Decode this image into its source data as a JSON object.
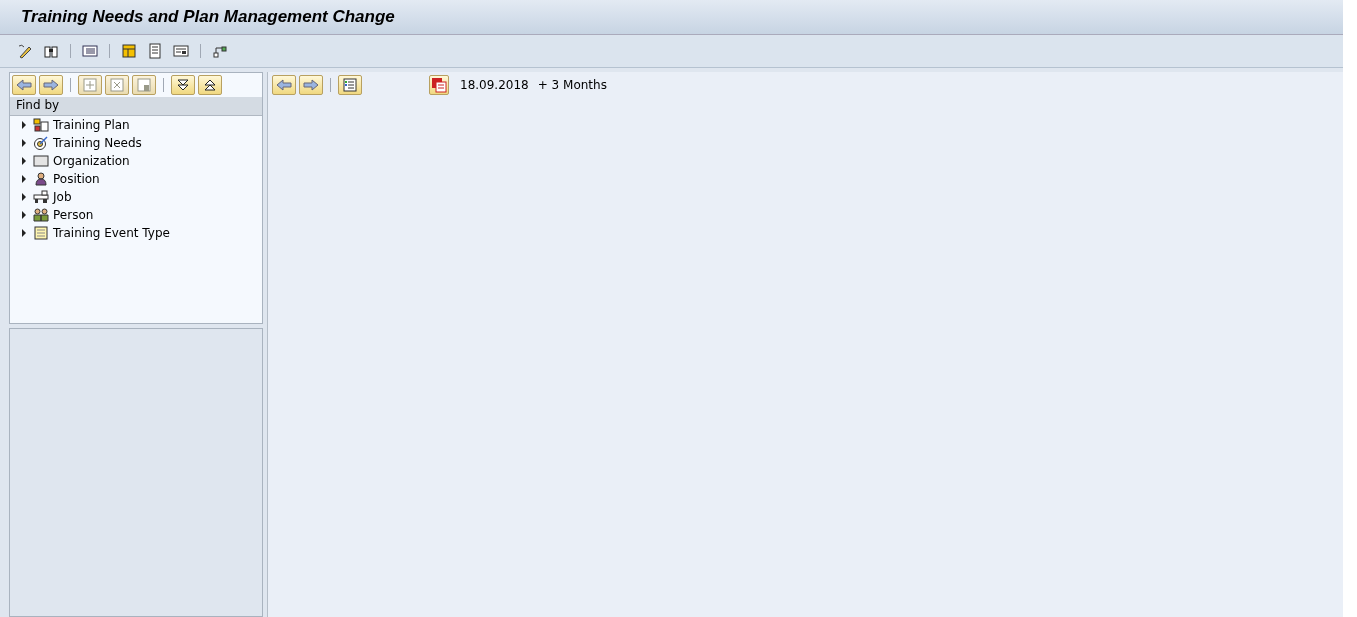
{
  "window": {
    "title": "Training Needs and Plan Management Change"
  },
  "left_panel": {
    "header": "Find by",
    "items": [
      {
        "label": "Training Plan",
        "kind": "plan",
        "expanded": false
      },
      {
        "label": "Training Needs",
        "kind": "needs",
        "expanded": false
      },
      {
        "label": "Organization",
        "kind": "org",
        "expanded": false
      },
      {
        "label": "Position",
        "kind": "position",
        "expanded": false
      },
      {
        "label": "Job",
        "kind": "job",
        "expanded": false
      },
      {
        "label": "Person",
        "kind": "person",
        "expanded": false
      },
      {
        "label": "Training Event Type",
        "kind": "eventtype",
        "expanded": false
      }
    ]
  },
  "period": {
    "date": "18.09.2018",
    "span": "+ 3 Months"
  }
}
